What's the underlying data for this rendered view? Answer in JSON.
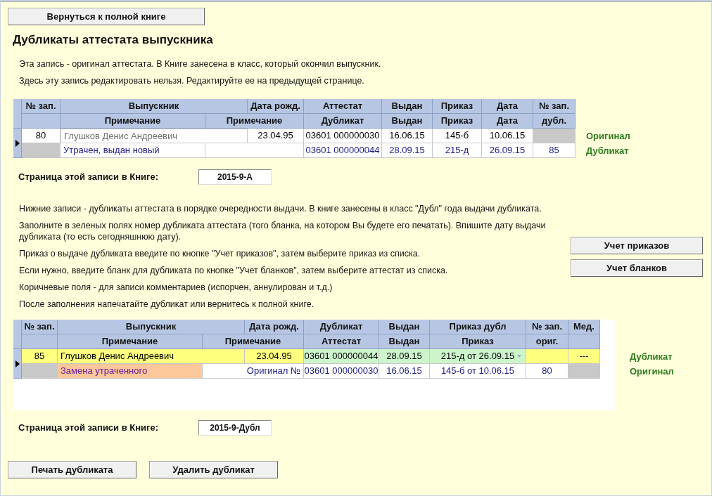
{
  "back_button": "Вернуться к полной книге",
  "title": "Дубликаты аттестата выпускника",
  "intro": [
    "Эта запись - оригинал аттестата. В Книге занесена в класс, который окончил выпускник.",
    "Здесь эту запись редактировать нельзя. Редактируйте ее на предыдущей странице."
  ],
  "original_table": {
    "header_top": [
      {
        "text": "№ зап."
      },
      {
        "text": "Выпускник"
      },
      {
        "text": "Дата рожд."
      },
      {
        "text": "Аттестат"
      },
      {
        "text": "Выдан"
      },
      {
        "text": "Приказ"
      },
      {
        "text": "Дата"
      },
      {
        "text": "№ зап."
      }
    ],
    "header_bottom": [
      {
        "kind": "blank"
      },
      {
        "text": "Примечание"
      },
      {
        "text": "Примечание"
      },
      {
        "text": "Дубликат"
      },
      {
        "text": "Выдан"
      },
      {
        "text": "Приказ"
      },
      {
        "text": "Дата"
      },
      {
        "text": "дубл."
      }
    ],
    "records": [
      {
        "selected": true,
        "lines": [
          {
            "label": "Оригинал",
            "cells": [
              {
                "text": "80",
                "kind": "plain"
              },
              {
                "text": "Глушков Денис Андреевич",
                "kind": "namebox"
              },
              {
                "text": "23.04.95",
                "kind": "plain"
              },
              {
                "text": "03601 000000030",
                "kind": "plain"
              },
              {
                "text": "16.06.15",
                "kind": "plain"
              },
              {
                "text": "145-б",
                "kind": "plain"
              },
              {
                "text": "10.06.15",
                "kind": "plain"
              },
              {
                "kind": "grey"
              }
            ]
          },
          {
            "label": "Дубликат",
            "cells": [
              {
                "kind": "grey"
              },
              {
                "text": "Утрачен, выдан новый",
                "kind": "linkleft"
              },
              {
                "kind": "link"
              },
              {
                "text": "03601 000000044",
                "kind": "link"
              },
              {
                "text": "28.09.15",
                "kind": "link"
              },
              {
                "text": "215-д",
                "kind": "link"
              },
              {
                "text": "26.09.15",
                "kind": "link"
              },
              {
                "text": "85",
                "kind": "link"
              }
            ]
          }
        ]
      }
    ]
  },
  "original_page": {
    "label": "Страница этой записи в Книге:",
    "value": "2015-9-А"
  },
  "instructions": [
    "Нижние записи - дубликаты аттестата в порядке очередности выдачи. В книге занесены в класс \"Дубл\" года выдачи дубликата.",
    "Заполните в зеленых полях номер дубликата аттестата (того бланка, на котором Вы будете его печатать). Впишите дату выдачи дубликата (то есть сегодняшнюю дату).",
    "Приказ о выдаче дубликата введите по кнопке \"Учет приказов\", затем выберите приказ из списка.",
    "Если нужно, введите бланк для дубликата по кнопке \"Учет бланков\", затем выберите аттестат из списка.",
    "Коричневые поля - для записи комментариев (испорчен, аннулирован и т.д.)",
    "После заполнения напечатайте дубликат или вернитесь к полной книге."
  ],
  "side_buttons": [
    "Учет приказов",
    "Учет бланков"
  ],
  "duplicate_table": {
    "header_top": [
      {
        "text": "№ зап."
      },
      {
        "text": "Выпускник"
      },
      {
        "text": "Дата рожд."
      },
      {
        "text": "Дубликат"
      },
      {
        "text": "Выдан"
      },
      {
        "text": "Приказ дубл"
      },
      {
        "text": "№ зап."
      },
      {
        "text": "Мед."
      }
    ],
    "header_bottom": [
      {
        "kind": "blank"
      },
      {
        "text": "Примечание"
      },
      {
        "text": "Примечание"
      },
      {
        "text": "Аттестат"
      },
      {
        "text": "Выдан"
      },
      {
        "text": "Приказ"
      },
      {
        "text": "ориг."
      },
      {
        "kind": "blank"
      }
    ],
    "records": [
      {
        "selected": true,
        "lines": [
          {
            "label": "Дубликат",
            "cells": [
              {
                "text": "85",
                "kind": "yellow"
              },
              {
                "text": "Глушков Денис Андреевич",
                "kind": "yellowleft"
              },
              {
                "text": "23.04.95",
                "kind": "yellow"
              },
              {
                "text": "03601 000000044",
                "kind": "green"
              },
              {
                "text": "28.09.15",
                "kind": "green"
              },
              {
                "text": "215-д от 26.09.15",
                "kind": "dropdown"
              },
              {
                "kind": "yellow"
              },
              {
                "text": "---",
                "kind": "yellow"
              }
            ]
          },
          {
            "label": "Оригинал",
            "cells": [
              {
                "kind": "grey"
              },
              {
                "text": "Замена утраченного",
                "kind": "brown"
              },
              {
                "text": "Оригинал №",
                "kind": "linkright"
              },
              {
                "text": "03601 000000030",
                "kind": "link"
              },
              {
                "text": "16.06.15",
                "kind": "link"
              },
              {
                "text": "145-б от 10.06.15",
                "kind": "link"
              },
              {
                "text": "80",
                "kind": "link"
              },
              {
                "kind": "grey"
              }
            ]
          }
        ]
      }
    ]
  },
  "duplicate_page": {
    "label": "Страница этой записи в Книге:",
    "value": "2015-9-Дубл"
  },
  "bottom_buttons": [
    "Печать дубликата",
    "Удалить дубликат"
  ]
}
